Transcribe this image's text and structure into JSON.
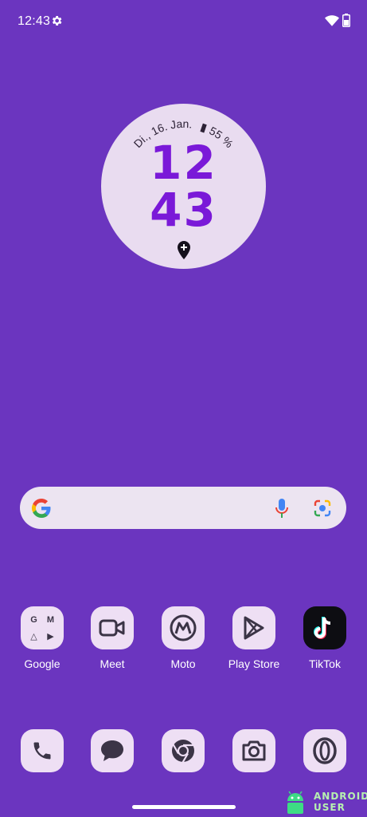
{
  "status_bar": {
    "time": "12:43"
  },
  "clock_widget": {
    "date_text": "Di., 16. Jan.",
    "battery_text": "55 %",
    "hours": "12",
    "minutes": "43"
  },
  "apps_row": [
    {
      "label": "Google",
      "icon": "google-folder-icon",
      "folder_items": [
        "G",
        "M",
        "△",
        "▶"
      ]
    },
    {
      "label": "Meet",
      "icon": "video-camera-icon"
    },
    {
      "label": "Moto",
      "icon": "motorola-logo-icon"
    },
    {
      "label": "Play Store",
      "icon": "play-store-icon"
    },
    {
      "label": "TikTok",
      "icon": "tiktok-icon"
    }
  ],
  "dock": [
    {
      "icon": "phone-icon"
    },
    {
      "icon": "messages-icon"
    },
    {
      "icon": "chrome-icon"
    },
    {
      "icon": "camera-icon"
    },
    {
      "icon": "opera-icon"
    }
  ],
  "watermark": {
    "line1": "ANDROID",
    "line2": "USER"
  },
  "colors": {
    "wallpaper": "#6b35bf",
    "clock_face": "#e9dcf0",
    "clock_digits": "#7a19d8",
    "icon_tile": "#eedff4",
    "icon_glyph": "#3b3446"
  }
}
